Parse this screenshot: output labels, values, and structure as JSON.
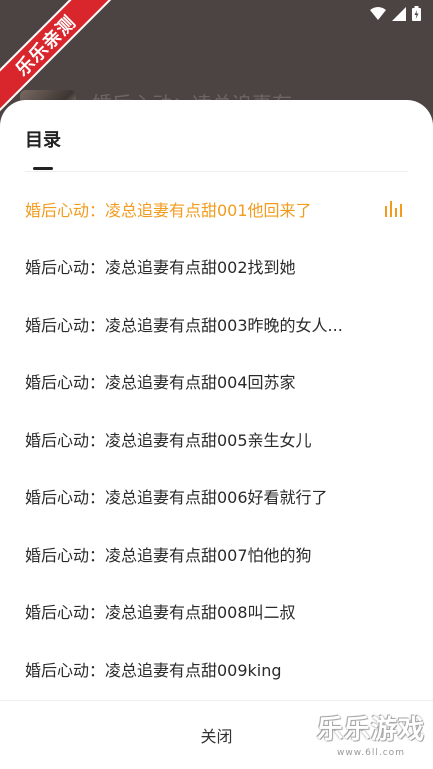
{
  "watermark_corner": {
    "text": "乐乐亲测"
  },
  "background_app": {
    "title": "婚后心动：凌总追妻有"
  },
  "sheet": {
    "title": "目录",
    "chapters": [
      {
        "label": "婚后心动：凌总追妻有点甜001他回来了",
        "active": true
      },
      {
        "label": "婚后心动：凌总追妻有点甜002找到她",
        "active": false
      },
      {
        "label": "婚后心动：凌总追妻有点甜003昨晚的女人...",
        "active": false
      },
      {
        "label": "婚后心动：凌总追妻有点甜004回苏家",
        "active": false
      },
      {
        "label": "婚后心动：凌总追妻有点甜005亲生女儿",
        "active": false
      },
      {
        "label": "婚后心动：凌总追妻有点甜006好看就行了",
        "active": false
      },
      {
        "label": "婚后心动：凌总追妻有点甜007怕他的狗",
        "active": false
      },
      {
        "label": "婚后心动：凌总追妻有点甜008叫二叔",
        "active": false
      },
      {
        "label": "婚后心动：凌总追妻有点甜009king",
        "active": false
      }
    ],
    "playing_icon": "equalizer-icon",
    "close_label": "关闭"
  },
  "watermark_bottom": {
    "main": "乐乐游戏",
    "url": "www.6ll.com"
  },
  "colors": {
    "accent": "#f29b1d",
    "overlay": "#4b4443",
    "text": "#2a2a2a"
  }
}
